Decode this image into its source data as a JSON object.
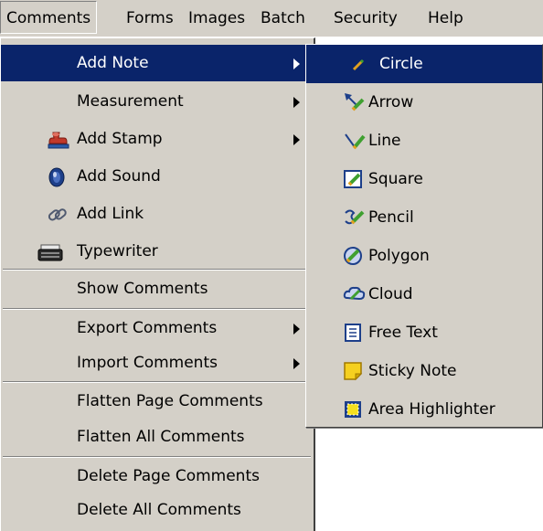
{
  "menubar": {
    "items": [
      "Comments",
      "Forms",
      "Images",
      "Batch",
      "Security",
      "Help"
    ],
    "active": "Comments"
  },
  "comments_menu": {
    "add_note": "Add Note",
    "measurement": "Measurement",
    "add_stamp": "Add Stamp",
    "add_sound": "Add Sound",
    "add_link": "Add Link",
    "typewriter": "Typewriter",
    "show_comments": "Show Comments",
    "export_comments": "Export Comments",
    "import_comments": "Import Comments",
    "flatten_page_comments": "Flatten Page Comments",
    "flatten_all_comments": "Flatten All Comments",
    "delete_page_comments": "Delete Page Comments",
    "delete_all_comments": "Delete All Comments",
    "selected": "Add Note"
  },
  "add_note_submenu": {
    "items": [
      "Circle",
      "Arrow",
      "Line",
      "Square",
      "Pencil",
      "Polygon",
      "Cloud",
      "Free Text",
      "Sticky Note",
      "Area Highlighter"
    ],
    "selected": "Circle"
  },
  "colors": {
    "menu_bg": "#d4d0c8",
    "selection": "#0a246a",
    "selection_text": "#ffffff"
  },
  "icons": {
    "add_stamp": "stamp-icon",
    "add_sound": "speaker-icon",
    "add_link": "chain-link-icon",
    "typewriter": "typewriter-icon",
    "circle": "pen-icon",
    "arrow": "arrow-icon",
    "line": "line-icon",
    "square": "square-icon",
    "pencil": "pencil-icon",
    "polygon": "polygon-icon",
    "cloud": "cloud-icon",
    "free_text": "text-box-icon",
    "sticky_note": "sticky-note-icon",
    "area_highlighter": "area-highlighter-icon"
  }
}
